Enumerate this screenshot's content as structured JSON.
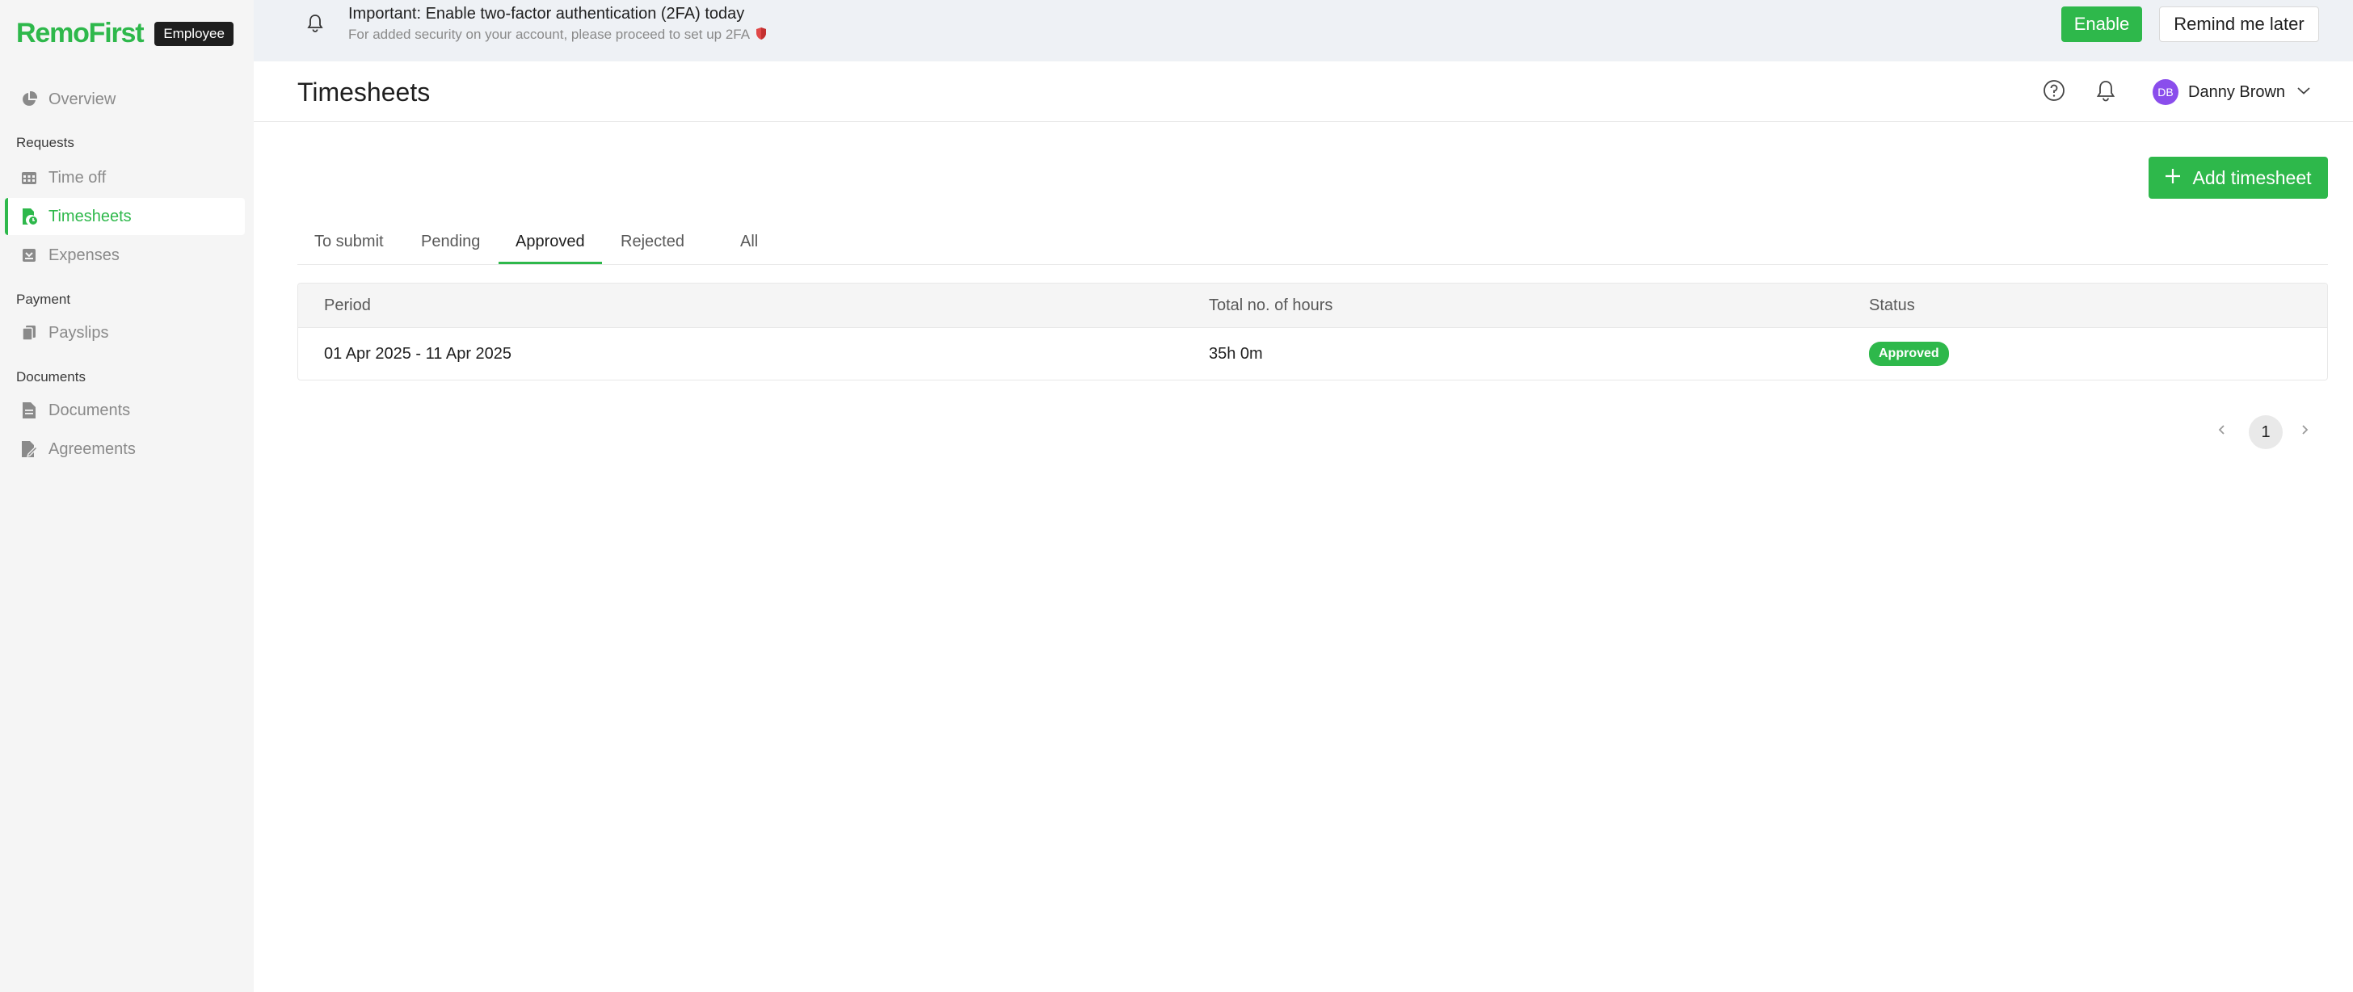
{
  "brand": {
    "logo": "RemoFirst",
    "role_badge": "Employee"
  },
  "sidebar": {
    "overview": {
      "label": "Overview",
      "icon": "pie-chart-icon"
    },
    "sections": [
      {
        "title": "Requests",
        "items": [
          {
            "label": "Time off",
            "icon": "calendar-icon"
          },
          {
            "label": "Timesheets",
            "icon": "timesheet-icon",
            "active": true
          },
          {
            "label": "Expenses",
            "icon": "receipt-icon"
          }
        ]
      },
      {
        "title": "Payment",
        "items": [
          {
            "label": "Payslips",
            "icon": "payslip-icon"
          }
        ]
      },
      {
        "title": "Documents",
        "items": [
          {
            "label": "Documents",
            "icon": "document-icon"
          },
          {
            "label": "Agreements",
            "icon": "signature-icon"
          }
        ]
      }
    ]
  },
  "banner": {
    "title": "Important: Enable two-factor authentication (2FA) today",
    "subtitle": "For added security on your account, please proceed to set up 2FA",
    "enable_label": "Enable",
    "remind_label": "Remind me later"
  },
  "header": {
    "title": "Timesheets",
    "user": {
      "initials": "DB",
      "name": "Danny Brown"
    }
  },
  "actions": {
    "add_label": "Add timesheet"
  },
  "tabs": [
    {
      "label": "To submit"
    },
    {
      "label": "Pending"
    },
    {
      "label": "Approved",
      "active": true
    },
    {
      "label": "Rejected"
    },
    {
      "label": "All"
    }
  ],
  "table": {
    "columns": [
      "Period",
      "Total no. of hours",
      "Status"
    ],
    "rows": [
      {
        "period": "01 Apr 2025 - 11 Apr 2025",
        "hours": "35h 0m",
        "status": "Approved"
      }
    ]
  },
  "pagination": {
    "current_page": "1"
  },
  "colors": {
    "accent": "#2eb84b",
    "avatar": "#8a4dec",
    "sidebar_bg": "#f5f5f5",
    "banner_bg": "#eef1f5"
  }
}
